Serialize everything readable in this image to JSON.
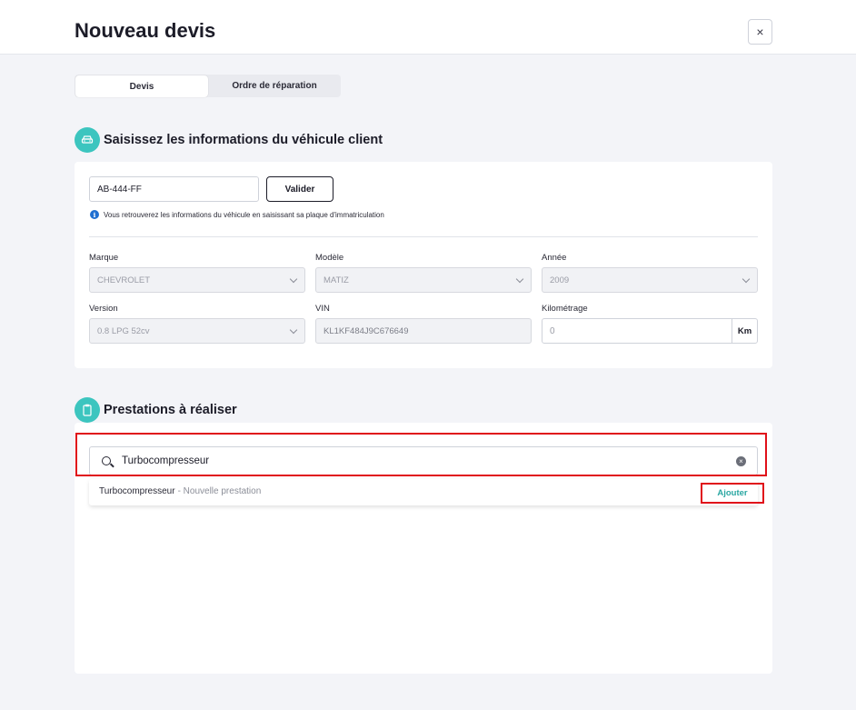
{
  "header": {
    "title": "Nouveau devis",
    "close_label": "×"
  },
  "tabs": [
    {
      "label": "Devis",
      "active": true
    },
    {
      "label": "Ordre de réparation",
      "active": false
    }
  ],
  "vehicle_section": {
    "icon": "car-icon",
    "title": "Saisissez les informations du véhicule client",
    "plate_value": "AB-444-FF",
    "validate_label": "Valider",
    "info_icon": "i",
    "info_text": "Vous retrouverez les informations du véhicule en saisissant sa plaque d'immatriculation",
    "fields": {
      "marque": {
        "label": "Marque",
        "value": "CHEVROLET"
      },
      "modele": {
        "label": "Modèle",
        "value": "MATIZ"
      },
      "annee": {
        "label": "Année",
        "value": "2009"
      },
      "version": {
        "label": "Version",
        "value": "0.8 LPG 52cv"
      },
      "vin": {
        "label": "VIN",
        "value": "KL1KF484J9C676649"
      },
      "kilometrage": {
        "label": "Kilométrage",
        "value": "0",
        "unit": "Km"
      }
    }
  },
  "prestations_section": {
    "icon": "clipboard-icon",
    "title": "Prestations à réaliser",
    "search_value": "Turbocompresseur",
    "suggestion": {
      "name": "Turbocompresseur",
      "subtitle": "- Nouvelle prestation",
      "action_label": "Ajouter"
    }
  },
  "colors": {
    "accent": "#3cc5bf",
    "highlight": "#e0101a",
    "action": "#2aa7a2",
    "info": "#1f6fd1"
  }
}
